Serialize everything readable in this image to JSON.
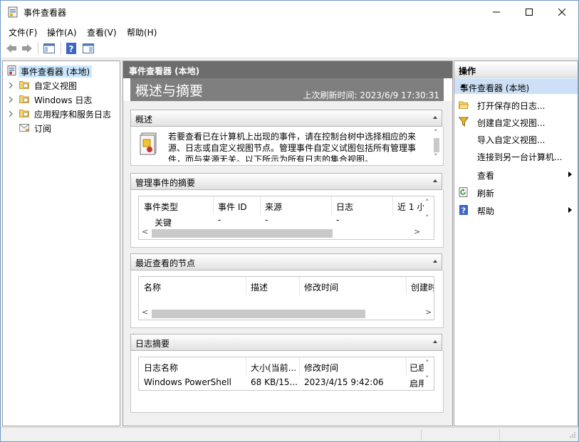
{
  "window": {
    "title": "事件查看器",
    "controls": [
      "minimize-icon",
      "maximize-icon",
      "close-icon"
    ]
  },
  "menu": {
    "items": [
      "文件(F)",
      "操作(A)",
      "查看(V)",
      "帮助(H)"
    ]
  },
  "toolbar": {
    "icons": [
      "back-arrow-icon",
      "forward-arrow-icon",
      "console-tree-icon",
      "help-icon",
      "properties-pane-icon"
    ]
  },
  "tree": {
    "items": [
      {
        "label": "事件查看器 (本地)",
        "icon": "event-viewer-icon",
        "expander": false,
        "selected": true
      },
      {
        "label": "自定义视图",
        "icon": "folder-icon",
        "expander": true
      },
      {
        "label": "Windows 日志",
        "icon": "folder-icon",
        "expander": true
      },
      {
        "label": "应用程序和服务日志",
        "icon": "folder-icon",
        "expander": true
      },
      {
        "label": "订阅",
        "icon": "subscription-icon",
        "expander": false
      }
    ]
  },
  "center": {
    "header": "事件查看器 (本地)",
    "banner_title": "概述与摘要",
    "last_refresh": "上次刷新时间: 2023/6/9 17:30:31",
    "overview": {
      "title": "概述",
      "text": "若要查看已在计算机上出现的事件，请在控制台树中选择相应的来源、日志或自定义视图节点。管理事件自定义试图包括所有管理事件，而与来源无关。以下所示为所有日志的集合视图。"
    },
    "admin_summary": {
      "title": "管理事件的摘要",
      "columns": [
        "事件类型",
        "事件 ID",
        "来源",
        "日志",
        "近 1 小"
      ],
      "rows": [
        [
          "关键",
          "-",
          "-",
          "-",
          ""
        ]
      ]
    },
    "recent_nodes": {
      "title": "最近查看的节点",
      "columns": [
        "名称",
        "描述",
        "修改时间",
        "创建时"
      ]
    },
    "log_summary": {
      "title": "日志摘要",
      "columns": [
        "日志名称",
        "大小(当前...",
        "修改时间",
        "已启"
      ],
      "rows": [
        [
          "Windows PowerShell",
          "68 KB/15...",
          "2023/4/15 9:42:06",
          "启用"
        ]
      ]
    }
  },
  "actions": {
    "header": "操作",
    "section": "事件查看器 (本地)",
    "items": [
      {
        "label": "打开保存的日志...",
        "icon": "open-folder-icon",
        "submenu": false
      },
      {
        "label": "创建自定义视图...",
        "icon": "filter-icon",
        "submenu": false
      },
      {
        "label": "导入自定义视图...",
        "icon": "",
        "submenu": false
      },
      {
        "label": "连接到另一台计算机...",
        "icon": "",
        "submenu": false
      },
      {
        "label": "查看",
        "icon": "",
        "submenu": true
      },
      {
        "label": "刷新",
        "icon": "refresh-icon",
        "submenu": false
      },
      {
        "label": "帮助",
        "icon": "help-icon",
        "submenu": true
      }
    ]
  }
}
